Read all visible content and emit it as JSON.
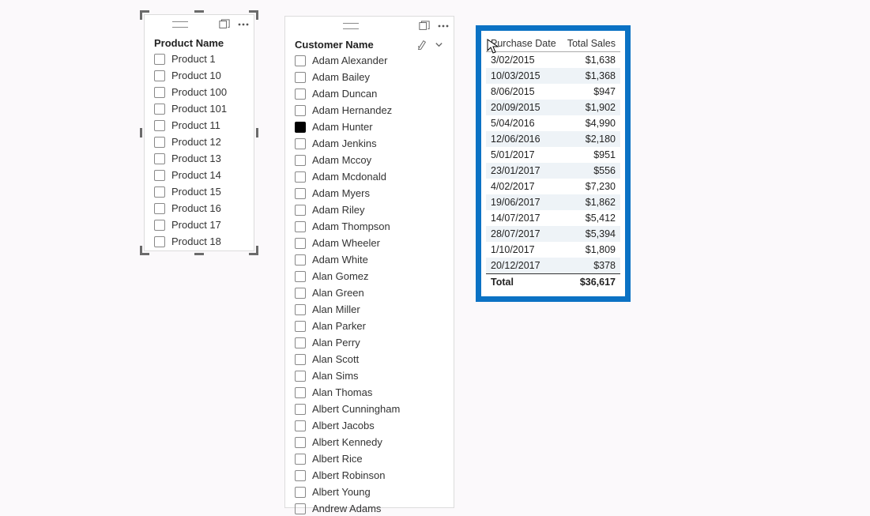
{
  "productSlicer": {
    "title": "Product Name",
    "items": [
      {
        "label": "Product 1",
        "checked": false
      },
      {
        "label": "Product 10",
        "checked": false
      },
      {
        "label": "Product 100",
        "checked": false
      },
      {
        "label": "Product 101",
        "checked": false
      },
      {
        "label": "Product 11",
        "checked": false
      },
      {
        "label": "Product 12",
        "checked": false
      },
      {
        "label": "Product 13",
        "checked": false
      },
      {
        "label": "Product 14",
        "checked": false
      },
      {
        "label": "Product 15",
        "checked": false
      },
      {
        "label": "Product 16",
        "checked": false
      },
      {
        "label": "Product 17",
        "checked": false
      },
      {
        "label": "Product 18",
        "checked": false
      }
    ]
  },
  "customerSlicer": {
    "title": "Customer Name",
    "items": [
      {
        "label": "Adam Alexander",
        "checked": false
      },
      {
        "label": "Adam Bailey",
        "checked": false
      },
      {
        "label": "Adam Duncan",
        "checked": false
      },
      {
        "label": "Adam Hernandez",
        "checked": false
      },
      {
        "label": "Adam Hunter",
        "checked": true
      },
      {
        "label": "Adam Jenkins",
        "checked": false
      },
      {
        "label": "Adam Mccoy",
        "checked": false
      },
      {
        "label": "Adam Mcdonald",
        "checked": false
      },
      {
        "label": "Adam Myers",
        "checked": false
      },
      {
        "label": "Adam Riley",
        "checked": false
      },
      {
        "label": "Adam Thompson",
        "checked": false
      },
      {
        "label": "Adam Wheeler",
        "checked": false
      },
      {
        "label": "Adam White",
        "checked": false
      },
      {
        "label": "Alan Gomez",
        "checked": false
      },
      {
        "label": "Alan Green",
        "checked": false
      },
      {
        "label": "Alan Miller",
        "checked": false
      },
      {
        "label": "Alan Parker",
        "checked": false
      },
      {
        "label": "Alan Perry",
        "checked": false
      },
      {
        "label": "Alan Scott",
        "checked": false
      },
      {
        "label": "Alan Sims",
        "checked": false
      },
      {
        "label": "Alan Thomas",
        "checked": false
      },
      {
        "label": "Albert Cunningham",
        "checked": false
      },
      {
        "label": "Albert Jacobs",
        "checked": false
      },
      {
        "label": "Albert Kennedy",
        "checked": false
      },
      {
        "label": "Albert Rice",
        "checked": false
      },
      {
        "label": "Albert Robinson",
        "checked": false
      },
      {
        "label": "Albert Young",
        "checked": false
      },
      {
        "label": "Andrew Adams",
        "checked": false
      }
    ]
  },
  "table": {
    "columns": [
      "Purchase Date",
      "Total Sales"
    ],
    "rows": [
      {
        "date": "3/02/2015",
        "sales": "$1,638"
      },
      {
        "date": "10/03/2015",
        "sales": "$1,368"
      },
      {
        "date": "8/06/2015",
        "sales": "$947"
      },
      {
        "date": "20/09/2015",
        "sales": "$1,902"
      },
      {
        "date": "5/04/2016",
        "sales": "$4,990"
      },
      {
        "date": "12/06/2016",
        "sales": "$2,180"
      },
      {
        "date": "5/01/2017",
        "sales": "$951"
      },
      {
        "date": "23/01/2017",
        "sales": "$556"
      },
      {
        "date": "4/02/2017",
        "sales": "$7,230"
      },
      {
        "date": "19/06/2017",
        "sales": "$1,862"
      },
      {
        "date": "14/07/2017",
        "sales": "$5,412"
      },
      {
        "date": "28/07/2017",
        "sales": "$5,394"
      },
      {
        "date": "1/10/2017",
        "sales": "$1,809"
      },
      {
        "date": "20/12/2017",
        "sales": "$378"
      }
    ],
    "total": {
      "label": "Total",
      "sales": "$36,617"
    }
  },
  "chart_data": {
    "type": "table",
    "title": "",
    "columns": [
      "Purchase Date",
      "Total Sales"
    ],
    "rows": [
      [
        "3/02/2015",
        1638
      ],
      [
        "10/03/2015",
        1368
      ],
      [
        "8/06/2015",
        947
      ],
      [
        "20/09/2015",
        1902
      ],
      [
        "5/04/2016",
        4990
      ],
      [
        "12/06/2016",
        2180
      ],
      [
        "5/01/2017",
        951
      ],
      [
        "23/01/2017",
        556
      ],
      [
        "4/02/2017",
        7230
      ],
      [
        "19/06/2017",
        1862
      ],
      [
        "14/07/2017",
        5412
      ],
      [
        "28/07/2017",
        5394
      ],
      [
        "1/10/2017",
        1809
      ],
      [
        "20/12/2017",
        378
      ]
    ],
    "total": 36617
  }
}
